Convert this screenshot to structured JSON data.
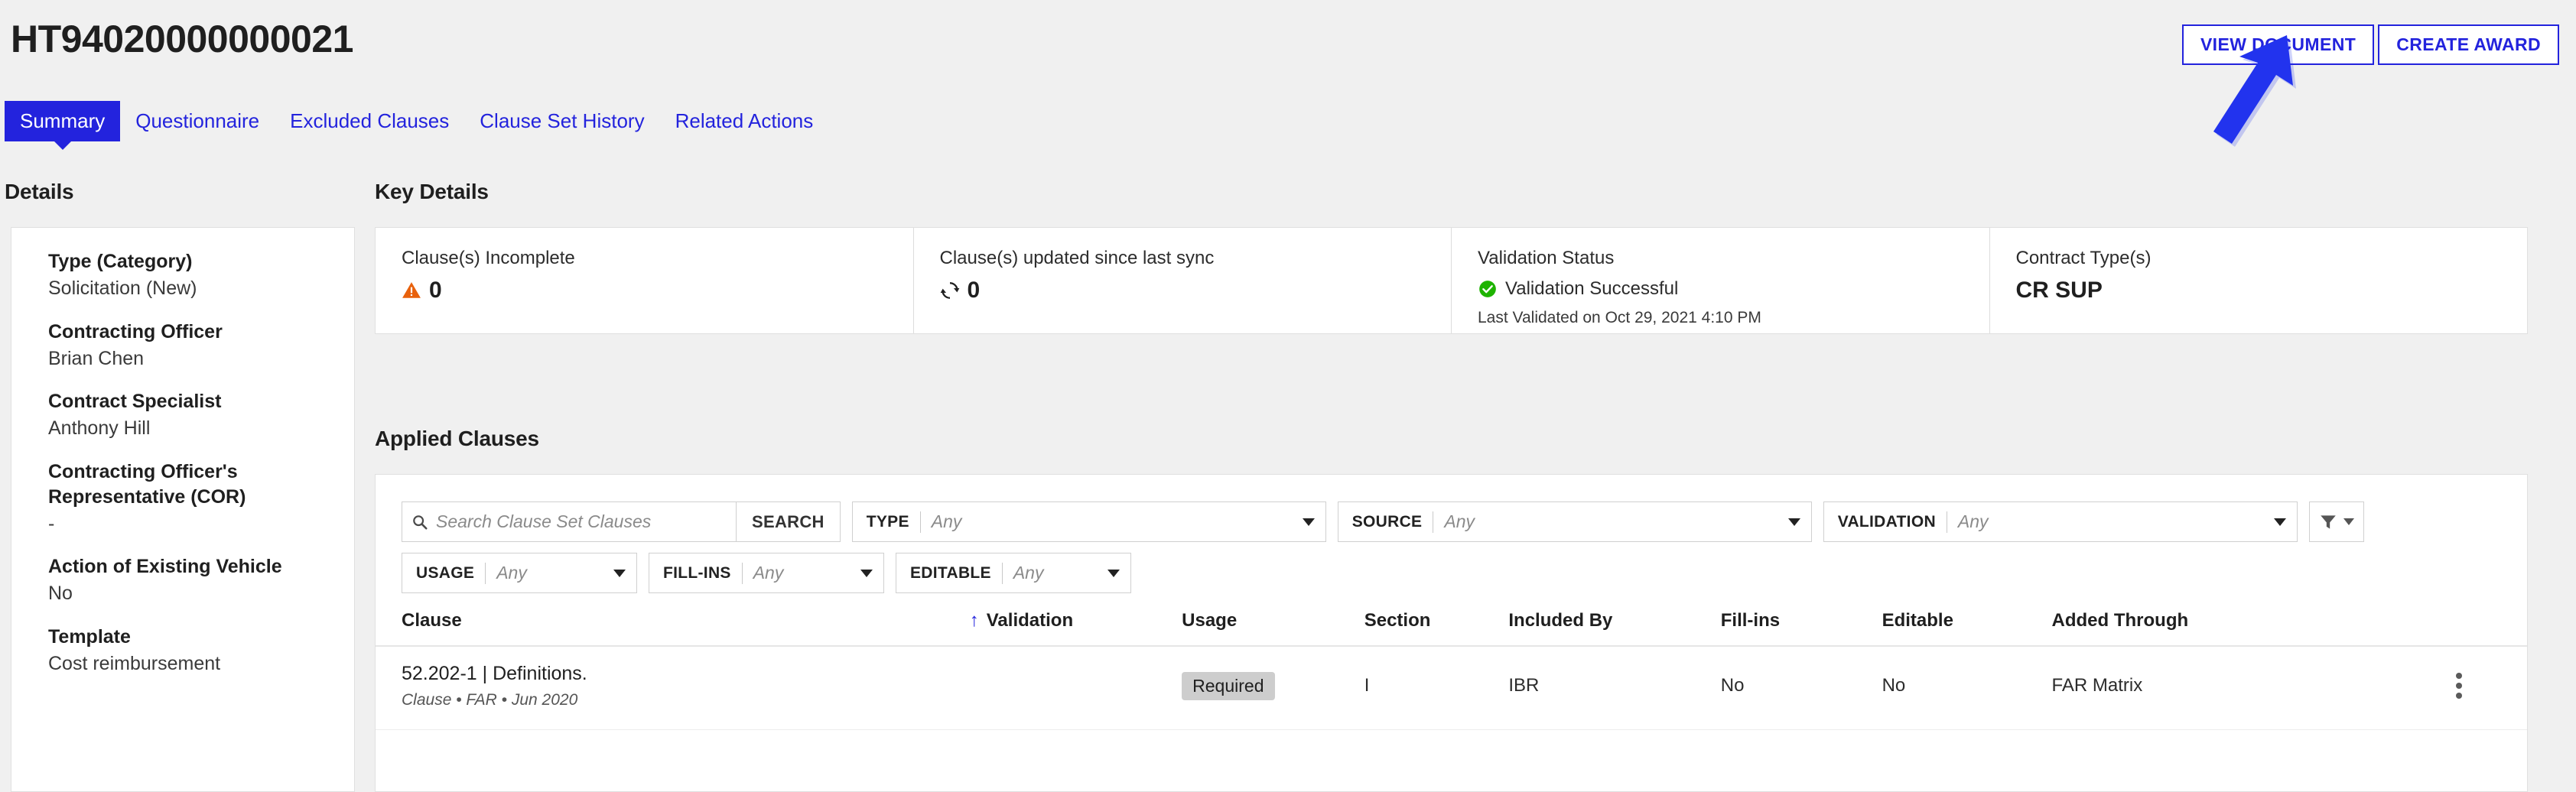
{
  "header": {
    "title": "HT94020000000021",
    "buttons": [
      {
        "label": "VIEW DOCUMENT",
        "name": "view-document-button"
      },
      {
        "label": "CREATE AWARD",
        "name": "create-award-button"
      }
    ]
  },
  "tabs": [
    {
      "label": "Summary",
      "active": true
    },
    {
      "label": "Questionnaire",
      "active": false
    },
    {
      "label": "Excluded Clauses",
      "active": false
    },
    {
      "label": "Clause Set History",
      "active": false
    },
    {
      "label": "Related Actions",
      "active": false
    }
  ],
  "sidebar": {
    "heading": "Details",
    "fields": [
      {
        "label": "Type (Category)",
        "value": "Solicitation (New)"
      },
      {
        "label": "Contracting Officer",
        "value": "Brian Chen"
      },
      {
        "label": "Contract Specialist",
        "value": "Anthony Hill"
      },
      {
        "label": "Contracting Officer's Representative (COR)",
        "value": "-"
      },
      {
        "label": "Action of Existing Vehicle",
        "value": "No"
      },
      {
        "label": "Template",
        "value": "Cost reimbursement"
      }
    ]
  },
  "key_details": {
    "heading": "Key Details",
    "cells": [
      {
        "title": "Clause(s) Incomplete",
        "value": "0",
        "icon": "warning-triangle-icon"
      },
      {
        "title": "Clause(s) updated since last sync",
        "value": "0",
        "icon": "sync-icon"
      },
      {
        "title": "Validation Status",
        "value": "Validation Successful",
        "icon": "check-circle-icon",
        "subnote": "Last Validated on Oct 29, 2021 4:10 PM"
      },
      {
        "title": "Contract Type(s)",
        "value": "CR SUP"
      }
    ]
  },
  "applied_clauses": {
    "heading": "Applied Clauses",
    "search": {
      "placeholder": "Search Clause Set Clauses",
      "value": "",
      "button_label": "SEARCH"
    },
    "filters": [
      {
        "label": "TYPE",
        "value": "Any"
      },
      {
        "label": "SOURCE",
        "value": "Any"
      },
      {
        "label": "VALIDATION",
        "value": "Any"
      },
      {
        "label": "USAGE",
        "value": "Any"
      },
      {
        "label": "FILL-INS",
        "value": "Any"
      },
      {
        "label": "EDITABLE",
        "value": "Any"
      }
    ],
    "columns": [
      "Clause",
      "Validation",
      "Usage",
      "Section",
      "Included By",
      "Fill-ins",
      "Editable",
      "Added Through"
    ],
    "sort_column": "Validation",
    "sort_direction": "asc",
    "rows": [
      {
        "clause": "52.202-1 | Definitions.",
        "clause_meta": "Clause • FAR • Jun 2020",
        "validation": "",
        "usage": "Required",
        "section": "I",
        "included_by": "IBR",
        "fill_ins": "No",
        "editable": "No",
        "added_through": "FAR Matrix"
      }
    ]
  },
  "colors": {
    "accent_blue": "#2323dd",
    "warning_orange": "#e8610c",
    "success_green": "#1eb300",
    "chip_gray": "#cdcdcd"
  }
}
